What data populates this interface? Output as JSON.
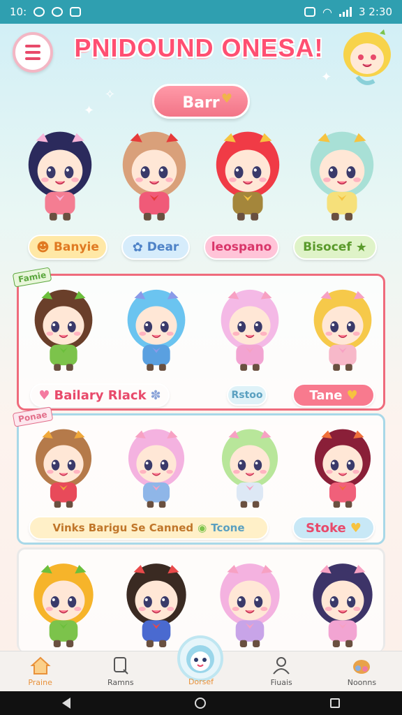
{
  "status_bar": {
    "left_text": "10:",
    "right_text": "3 2:30"
  },
  "header": {
    "title": "PNIDOUND ONESA!"
  },
  "top_button": {
    "label": "Barr"
  },
  "tags": [
    {
      "label": "Banyie",
      "bg": "#ffe8a6",
      "color": "#e07a22",
      "icon": "☻"
    },
    {
      "label": "Dear",
      "bg": "#d6ecfb",
      "color": "#4e82c7",
      "icon": "✿"
    },
    {
      "label": "leospano",
      "bg": "#ffc4d8",
      "color": "#d9366a",
      "icon": ""
    },
    {
      "label": "Bisocef",
      "bg": "#dff3c8",
      "color": "#5a9a2b",
      "icon": "★"
    }
  ],
  "panel1": {
    "label": "Famie",
    "pill_left": "Bailary Rlack",
    "pill_mid": "Rstoo",
    "pill_right": "Tane"
  },
  "panel2": {
    "label": "Ponae",
    "pill_left": "Vinks Barigu Se Canned",
    "pill_left_end": "Tcone",
    "pill_right": "Stoke"
  },
  "characters": {
    "row1": [
      {
        "hair": "#2b2a5c",
        "shirt": "#f47d92",
        "bow": "#f7b4d8"
      },
      {
        "hair": "#d9a07a",
        "shirt": "#f05a78",
        "bow": "#e63a3a"
      },
      {
        "hair": "#f03b46",
        "shirt": "#a4863b",
        "bow": "#f6c340"
      },
      {
        "hair": "#a8e0d6",
        "shirt": "#f6e07a",
        "bow": "#f6c340"
      }
    ],
    "panel1": [
      {
        "hair": "#6a3f2a",
        "shirt": "#7cc34b",
        "bow": "#6cbf3c"
      },
      {
        "hair": "#6bc4f0",
        "shirt": "#5aa0e0",
        "bow": "#8a9ae8"
      },
      {
        "hair": "#f4b9e6",
        "shirt": "#f2a4d2",
        "bow": "#f7a1c3"
      },
      {
        "hair": "#f6c94a",
        "shirt": "#f7b8c9",
        "bow": "#f7a1c3"
      }
    ],
    "panel2": [
      {
        "hair": "#b57a4a",
        "shirt": "#e84a5a",
        "bow": "#f0a83a"
      },
      {
        "hair": "#f4b2e0",
        "shirt": "#8fb6e8",
        "bow": "#f7a1c3"
      },
      {
        "hair": "#b8e69a",
        "shirt": "#dde8f5",
        "bow": "#f7a1c3"
      },
      {
        "hair": "#8a1f38",
        "shirt": "#f0607a",
        "bow": "#f0703a"
      }
    ],
    "panel3": [
      {
        "hair": "#f6b42a",
        "shirt": "#7cc34b",
        "bow": "#6cbf3c"
      },
      {
        "hair": "#3a2a22",
        "shirt": "#4a6ad0",
        "bow": "#e84a4a"
      },
      {
        "hair": "#f4b2e0",
        "shirt": "#c8a4e8",
        "bow": "#f7a1c3"
      },
      {
        "hair": "#3d3468",
        "shirt": "#f2a4d2",
        "bow": "#f7a1c3"
      }
    ]
  },
  "bottom_nav": [
    {
      "label": "Praine",
      "icon": "home-icon"
    },
    {
      "label": "Ramns",
      "icon": "search-icon"
    },
    {
      "label": "Dorsef",
      "icon": "mascot-icon"
    },
    {
      "label": "Fiuais",
      "icon": "profile-icon"
    },
    {
      "label": "Noonns",
      "icon": "basket-icon"
    }
  ]
}
